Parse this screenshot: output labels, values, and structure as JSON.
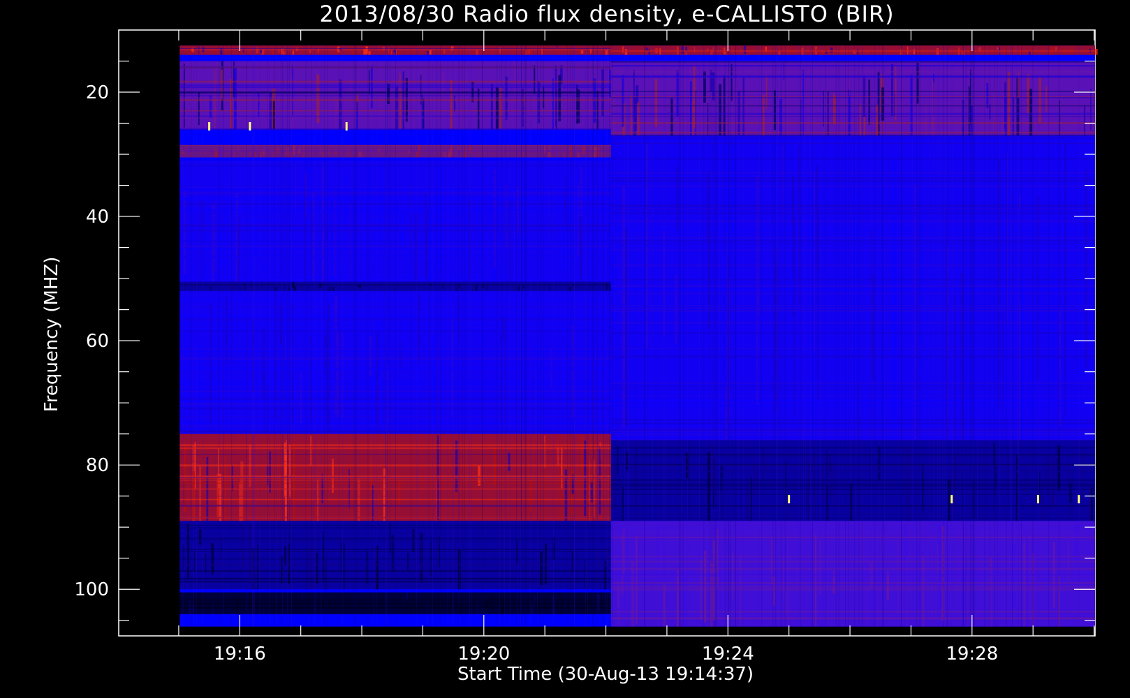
{
  "chart_data": {
    "type": "heatmap",
    "title": "2013/08/30  Radio flux density, e-CALLISTO (BIR)",
    "xlabel": "Start Time (30-Aug-13 19:14:37)",
    "ylabel": "Frequency (MHZ)",
    "x_unit": "UT time (HH:MM)",
    "x_start": "19:14:37",
    "xlim": [
      "19:14:01",
      "19:30:01"
    ],
    "data_extent_x": [
      "19:15:01",
      "19:30:01"
    ],
    "x_ticks": [
      "19:16",
      "19:20",
      "19:24",
      "19:28"
    ],
    "ylim": [
      10,
      107.5
    ],
    "y_inverted": true,
    "data_extent_y": [
      12.5,
      106
    ],
    "y_ticks": [
      20,
      40,
      60,
      80,
      100
    ],
    "colormap": [
      "#000000",
      "#0000ff",
      "#e00000",
      "#ffff80"
    ],
    "background_color": "#000000",
    "regime_change_time": "19:22:05",
    "bands_before_change": [
      {
        "freq_range": [
          12.5,
          14
        ],
        "level": "hot"
      },
      {
        "freq_range": [
          15,
          26
        ],
        "level": "mixed"
      },
      {
        "freq_range": [
          28.5,
          30.5
        ],
        "level": "warm"
      },
      {
        "freq_range": [
          31,
          50.5
        ],
        "level": "background"
      },
      {
        "freq_range": [
          50.5,
          52
        ],
        "level": "quiet"
      },
      {
        "freq_range": [
          52,
          75
        ],
        "level": "background"
      },
      {
        "freq_range": [
          75,
          89
        ],
        "level": "hot"
      },
      {
        "freq_range": [
          89,
          100
        ],
        "level": "quiet"
      },
      {
        "freq_range": [
          100.5,
          104
        ],
        "level": "very quiet"
      }
    ],
    "bands_after_change": [
      {
        "freq_range": [
          12.5,
          14
        ],
        "level": "hot"
      },
      {
        "freq_range": [
          15,
          27
        ],
        "level": "mixed"
      },
      {
        "freq_range": [
          27,
          76
        ],
        "level": "background"
      },
      {
        "freq_range": [
          76,
          89
        ],
        "level": "quiet"
      },
      {
        "freq_range": [
          89,
          106
        ],
        "level": "warm background"
      }
    ],
    "bright_features": [
      {
        "time": "19:15:30",
        "freq": 25.5
      },
      {
        "time": "19:16:10",
        "freq": 25.5
      },
      {
        "time": "19:17:45",
        "freq": 25.5
      },
      {
        "time": "19:25:00",
        "freq": 85.5
      },
      {
        "time": "19:27:40",
        "freq": 85.5
      },
      {
        "time": "19:29:05",
        "freq": 85.5
      },
      {
        "time": "19:29:45",
        "freq": 85.5
      }
    ]
  }
}
